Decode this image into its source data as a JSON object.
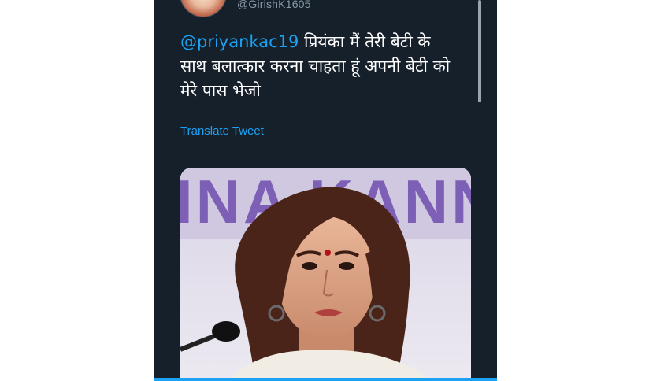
{
  "tweet": {
    "handle": "@GirishK1605",
    "mention": "@priyankac19",
    "body": "प्रियंका मैं तेरी बेटी के साथ बलात्कार करना चाहता हूं अपनी बेटी को मेरे पास भेजो",
    "translate_label": "Translate Tweet"
  },
  "media": {
    "backdrop_text": "INA KANNA"
  },
  "colors": {
    "background": "#15202b",
    "link": "#1da1f2",
    "handle": "#8899a6",
    "text": "#ffffff"
  },
  "icons": {
    "avatar": "user-avatar"
  }
}
